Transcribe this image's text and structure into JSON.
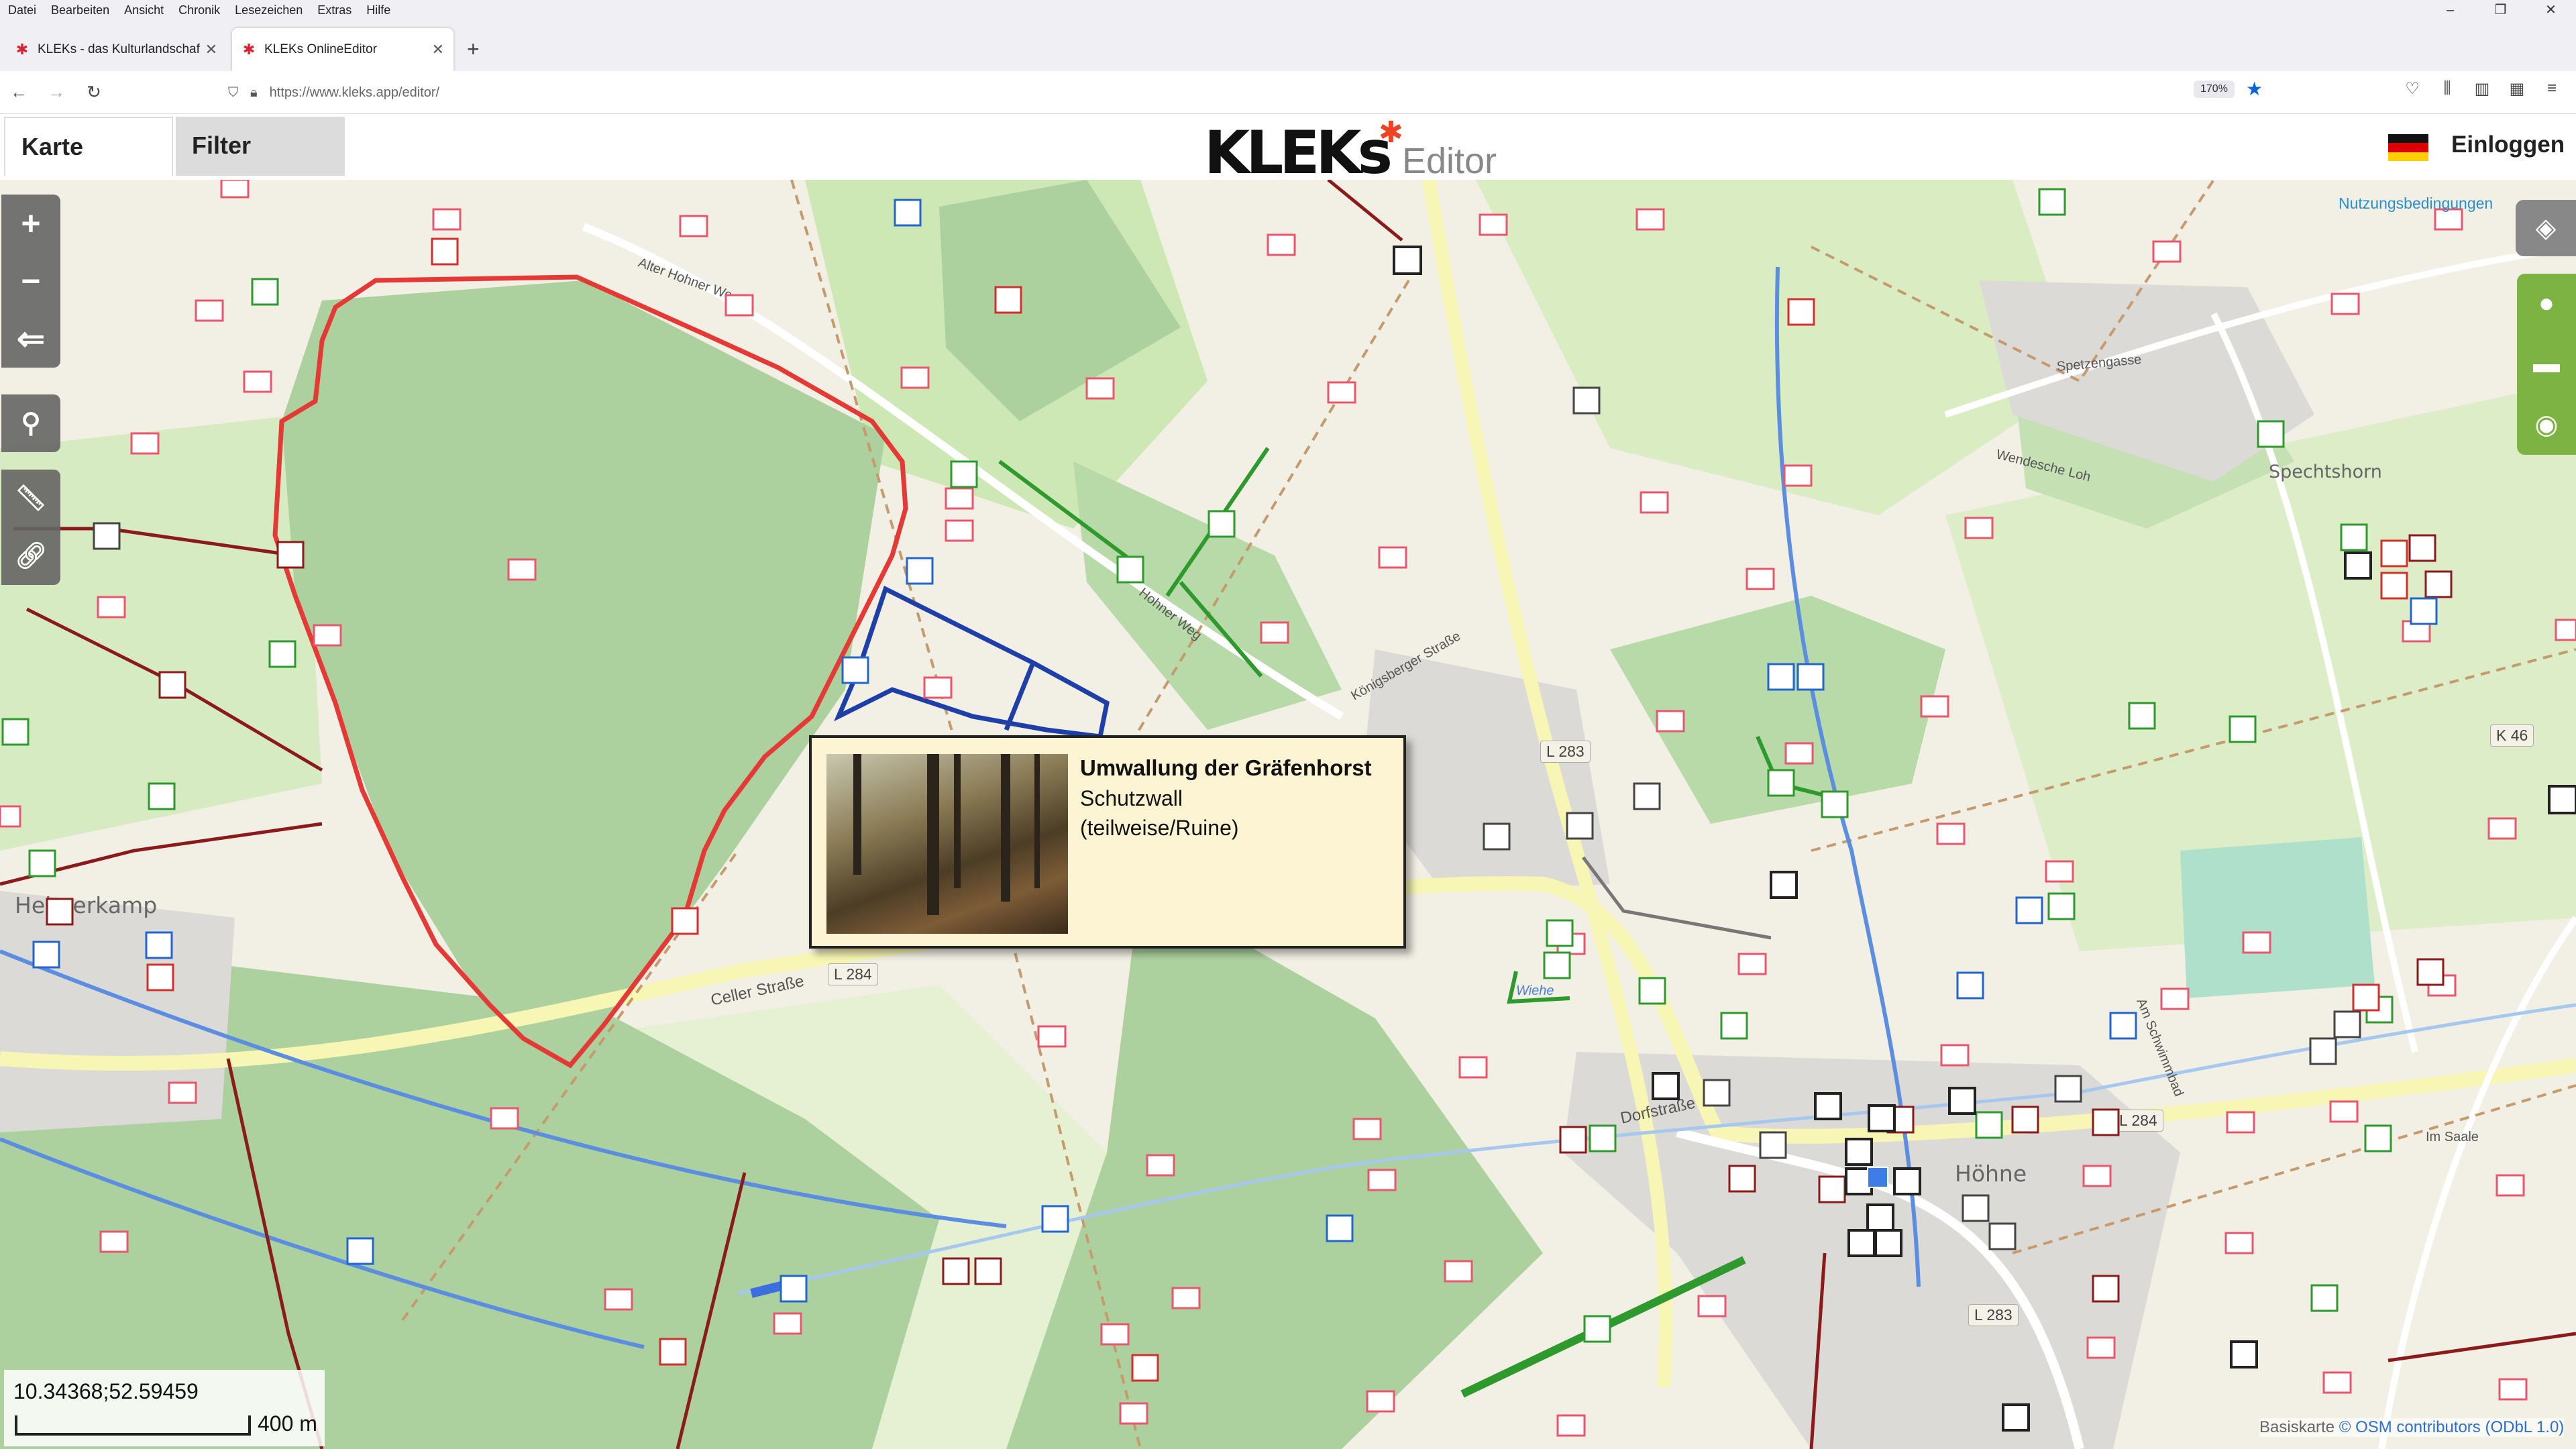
{
  "menubar": {
    "items": [
      "Datei",
      "Bearbeiten",
      "Ansicht",
      "Chronik",
      "Lesezeichen",
      "Extras",
      "Hilfe"
    ]
  },
  "tabs": [
    {
      "title": "KLEKs - das Kulturlandschafts-W",
      "active": false
    },
    {
      "title": "KLEKs OnlineEditor",
      "active": true
    }
  ],
  "navbar": {
    "url": "https://www.kleks.app/editor/",
    "zoom": "170%"
  },
  "app": {
    "tab_map": "Karte",
    "tab_filter": "Filter",
    "logo_text": "KLEKs",
    "logo_suffix": "Editor",
    "login": "Einloggen",
    "terms": "Nutzungsbedingungen"
  },
  "popup": {
    "title": "Umwallung der Gräfenhorst",
    "line1": "Schutzwall",
    "line2": "(teilweise/Ruine)"
  },
  "map": {
    "coordinates": "10.34368;52.59459",
    "scale": "400 m",
    "attribution_prefix": "Basiskarte ",
    "attribution_link": "© OSM contributors (ODbL 1.0)",
    "places": [
      "Helmerkamp",
      "Höhne",
      "Spechtshorn"
    ],
    "roads": [
      "L 284",
      "L 283",
      "L 284",
      "L 283",
      "K 46"
    ],
    "streets": [
      "Alter Hohner Weg",
      "Hohner Weg",
      "Celler Straße",
      "Dorfstraße",
      "Spetzengasse",
      "Wendesche Loh",
      "Am Schwimmbad",
      "Königsberger Straße",
      "Wiehe",
      "Im Saale"
    ],
    "colors": {
      "forest": "#add19e",
      "red_outline": "#e53935",
      "blue_outline": "#1e3fa8",
      "river": "#5b8de0",
      "paths": "#8b1a1a",
      "green_line": "#2e9a2e"
    }
  }
}
